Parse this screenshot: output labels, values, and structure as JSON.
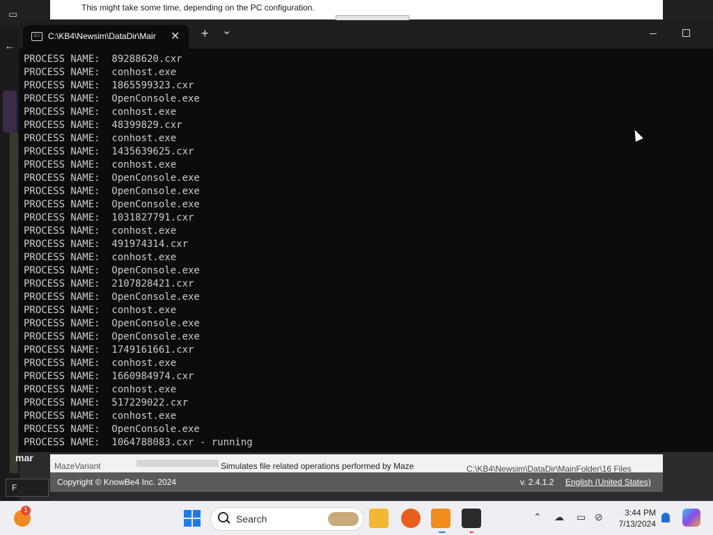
{
  "background": {
    "install_message": "This might take some time, depending on the PC configuration.",
    "left_field_value": "F",
    "left_text": "mar",
    "bottom_row": {
      "col1": "MazeVariant",
      "col3": "Simulates file related operations performed by Maze",
      "col4": "C:\\KB4\\Newsim\\DataDir\\MainFolder\\16 Files"
    },
    "footer": {
      "copyright": "Copyright © KnowBe4 Inc. 2024",
      "version": "v. 2.4.1.2",
      "language": "English (United States)"
    }
  },
  "terminal": {
    "tab_title": "C:\\KB4\\Newsim\\DataDir\\Mair",
    "new_tab_symbol": "+",
    "dropdown_symbol": "⌄",
    "lines": [
      "PROCESS NAME:  89288620.cxr",
      "PROCESS NAME:  conhost.exe",
      "PROCESS NAME:  1865599323.cxr",
      "PROCESS NAME:  OpenConsole.exe",
      "PROCESS NAME:  conhost.exe",
      "PROCESS NAME:  48399829.cxr",
      "PROCESS NAME:  conhost.exe",
      "PROCESS NAME:  1435639625.cxr",
      "PROCESS NAME:  conhost.exe",
      "PROCESS NAME:  OpenConsole.exe",
      "PROCESS NAME:  OpenConsole.exe",
      "PROCESS NAME:  OpenConsole.exe",
      "PROCESS NAME:  1031827791.cxr",
      "PROCESS NAME:  conhost.exe",
      "PROCESS NAME:  491974314.cxr",
      "PROCESS NAME:  conhost.exe",
      "PROCESS NAME:  OpenConsole.exe",
      "PROCESS NAME:  2107828421.cxr",
      "PROCESS NAME:  OpenConsole.exe",
      "PROCESS NAME:  conhost.exe",
      "PROCESS NAME:  OpenConsole.exe",
      "PROCESS NAME:  OpenConsole.exe",
      "PROCESS NAME:  1749161661.cxr",
      "PROCESS NAME:  conhost.exe",
      "PROCESS NAME:  1660984974.cxr",
      "PROCESS NAME:  conhost.exe",
      "PROCESS NAME:  517229022.cxr",
      "PROCESS NAME:  conhost.exe",
      "PROCESS NAME:  OpenConsole.exe",
      "PROCESS NAME:  1064788083.cxr - running"
    ]
  },
  "taskbar": {
    "weather_badge": "1",
    "search_label": "Search",
    "time": "3:44 PM",
    "date": "7/13/2024",
    "icons": [
      "start-icon",
      "file-explorer-icon",
      "firefox-icon",
      "knowbe4-app-icon",
      "terminal-icon"
    ],
    "colors": {
      "accent": "#1f7ae6",
      "folder": "#f2b833",
      "firefox": "#e8601c",
      "knowbe4": "#f28c1c",
      "terminal": "#2b2b2b"
    }
  }
}
